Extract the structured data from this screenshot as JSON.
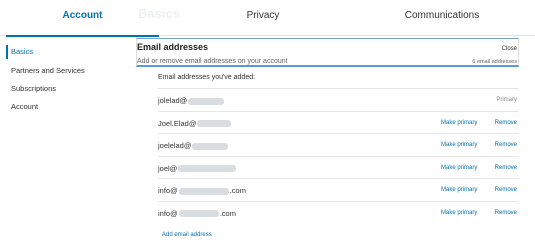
{
  "tabs": [
    {
      "label": "Account"
    },
    {
      "label": "Privacy"
    },
    {
      "label": "Communications"
    }
  ],
  "sidebar": {
    "items": [
      {
        "label": "Basics"
      },
      {
        "label": "Partners and Services"
      },
      {
        "label": "Subscriptions"
      },
      {
        "label": "Account"
      }
    ]
  },
  "main": {
    "background_heading": "Basics",
    "panel": {
      "title": "Email addresses",
      "subtitle": "Add or remove email addresses on your account",
      "close_label": "Close",
      "count_text": "6 email addresses"
    },
    "added_label": "Email addresses you've added:",
    "emails": [
      {
        "prefix": "jolelad@",
        "suffix": "",
        "status": "Primary"
      },
      {
        "prefix": "Joel.Elad@",
        "suffix": ""
      },
      {
        "prefix": "joelelad@",
        "suffix": ""
      },
      {
        "prefix": "joel@",
        "suffix": ""
      },
      {
        "prefix": "info@",
        "suffix": ".com"
      },
      {
        "prefix": "info@",
        "suffix": ".com"
      }
    ],
    "make_primary_label": "Make primary",
    "remove_label": "Remove",
    "add_email_label": "Add email address"
  },
  "colors": {
    "accent": "#0073b1",
    "panel_border": "#5b9bd0"
  }
}
